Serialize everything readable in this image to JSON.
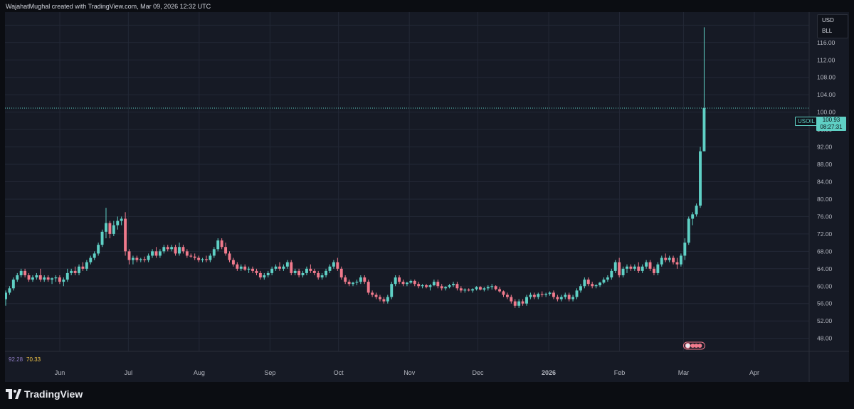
{
  "header": {
    "text": "WajahatMughal created with TradingView.com, Mar 09, 2026 12:32 UTC"
  },
  "units": {
    "currency": "USD",
    "measure": "BLL"
  },
  "symbol": {
    "name": "USOIL",
    "last_price": "100.93",
    "countdown": "08:27:31"
  },
  "oscillator": {
    "value_a": "92.28",
    "value_b": "70.33"
  },
  "brand": {
    "name": "TradingView"
  },
  "colors": {
    "up": "#5fd0c5",
    "down": "#f07a8c",
    "background": "#161a25",
    "grid": "#232836",
    "axis_text": "#b2b5be"
  },
  "chart_data": {
    "type": "candlestick",
    "symbol": "USOIL",
    "currency": "USD",
    "y_ticks": [
      48,
      52,
      56,
      60,
      64,
      68,
      72,
      76,
      80,
      84,
      88,
      92,
      96,
      100,
      104,
      108,
      112,
      116,
      120
    ],
    "y_tick_labels": [
      "48.00",
      "52.00",
      "56.00",
      "60.00",
      "64.00",
      "68.00",
      "72.00",
      "76.00",
      "80.00",
      "84.00",
      "88.00",
      "92.00",
      "96.00",
      "100.00",
      "104.00",
      "108.00",
      "112.00",
      "116.00",
      "120.00"
    ],
    "ylim": [
      45,
      123
    ],
    "x_labels": [
      "Jun",
      "Jul",
      "Aug",
      "Sep",
      "Oct",
      "Nov",
      "Dec",
      "2026",
      "Feb",
      "Mar",
      "Apr"
    ],
    "x_label_day_index": [
      24,
      54,
      85,
      116,
      146,
      177,
      207,
      238,
      269,
      297,
      328
    ],
    "x_range_days": [
      0,
      352
    ],
    "last_price": 100.93,
    "candles": [
      {
        "o": 57,
        "h": 59,
        "l": 55.5,
        "c": 58.5
      },
      {
        "o": 58.5,
        "h": 60,
        "l": 58,
        "c": 59.5
      },
      {
        "o": 59.5,
        "h": 62,
        "l": 59,
        "c": 61.5
      },
      {
        "o": 61.5,
        "h": 63,
        "l": 61,
        "c": 62.5
      },
      {
        "o": 62.5,
        "h": 64,
        "l": 62,
        "c": 63.5
      },
      {
        "o": 63.5,
        "h": 64,
        "l": 62,
        "c": 62.5
      },
      {
        "o": 62.5,
        "h": 63,
        "l": 61,
        "c": 61.5
      },
      {
        "o": 61.5,
        "h": 62.5,
        "l": 61,
        "c": 62
      },
      {
        "o": 62,
        "h": 63,
        "l": 61.5,
        "c": 62.5
      },
      {
        "o": 62.5,
        "h": 64,
        "l": 61,
        "c": 61.5
      },
      {
        "o": 61.5,
        "h": 62.5,
        "l": 61,
        "c": 62
      },
      {
        "o": 62,
        "h": 62.5,
        "l": 61,
        "c": 61.5
      },
      {
        "o": 61.5,
        "h": 62,
        "l": 60.5,
        "c": 61.8
      },
      {
        "o": 61.8,
        "h": 62.5,
        "l": 61,
        "c": 62
      },
      {
        "o": 62,
        "h": 62.5,
        "l": 60.5,
        "c": 61
      },
      {
        "o": 61,
        "h": 62,
        "l": 60,
        "c": 61.5
      },
      {
        "o": 61.5,
        "h": 64,
        "l": 61,
        "c": 63
      },
      {
        "o": 63,
        "h": 64,
        "l": 62.5,
        "c": 63.5
      },
      {
        "o": 63.5,
        "h": 64.5,
        "l": 62.5,
        "c": 63
      },
      {
        "o": 63,
        "h": 65,
        "l": 62.5,
        "c": 64.5
      },
      {
        "o": 64.5,
        "h": 65.5,
        "l": 63.5,
        "c": 64
      },
      {
        "o": 64,
        "h": 66,
        "l": 63.5,
        "c": 65.5
      },
      {
        "o": 65.5,
        "h": 67,
        "l": 65,
        "c": 66.5
      },
      {
        "o": 66.5,
        "h": 68,
        "l": 66,
        "c": 67.5
      },
      {
        "o": 67.5,
        "h": 70,
        "l": 67,
        "c": 69.5
      },
      {
        "o": 69.5,
        "h": 73,
        "l": 69,
        "c": 72.5
      },
      {
        "o": 72.5,
        "h": 78,
        "l": 71,
        "c": 74.5
      },
      {
        "o": 74.5,
        "h": 75,
        "l": 71,
        "c": 72
      },
      {
        "o": 72,
        "h": 75,
        "l": 71.5,
        "c": 74
      },
      {
        "o": 74,
        "h": 76,
        "l": 73,
        "c": 75
      },
      {
        "o": 75,
        "h": 76,
        "l": 74,
        "c": 75.5
      },
      {
        "o": 75.5,
        "h": 77,
        "l": 67,
        "c": 68
      },
      {
        "o": 68,
        "h": 68.5,
        "l": 65,
        "c": 66
      },
      {
        "o": 66,
        "h": 67,
        "l": 65,
        "c": 66.5
      },
      {
        "o": 66.5,
        "h": 67,
        "l": 65.5,
        "c": 66
      },
      {
        "o": 66,
        "h": 66.5,
        "l": 65.5,
        "c": 66.2
      },
      {
        "o": 66.2,
        "h": 66.8,
        "l": 65.5,
        "c": 66
      },
      {
        "o": 66,
        "h": 67.5,
        "l": 65.5,
        "c": 67
      },
      {
        "o": 67,
        "h": 68.5,
        "l": 66.5,
        "c": 68
      },
      {
        "o": 68,
        "h": 69,
        "l": 66.5,
        "c": 67
      },
      {
        "o": 67,
        "h": 68.5,
        "l": 66.5,
        "c": 68
      },
      {
        "o": 68,
        "h": 69.5,
        "l": 67.5,
        "c": 69
      },
      {
        "o": 69,
        "h": 69.5,
        "l": 68,
        "c": 68.5
      },
      {
        "o": 68.5,
        "h": 69.5,
        "l": 68,
        "c": 69
      },
      {
        "o": 69,
        "h": 69.5,
        "l": 67,
        "c": 67.5
      },
      {
        "o": 67.5,
        "h": 70,
        "l": 67,
        "c": 69
      },
      {
        "o": 69,
        "h": 69.5,
        "l": 67.5,
        "c": 68
      },
      {
        "o": 68,
        "h": 68.5,
        "l": 66.5,
        "c": 67
      },
      {
        "o": 67,
        "h": 67.5,
        "l": 66.5,
        "c": 66.8
      },
      {
        "o": 66.8,
        "h": 67.5,
        "l": 66,
        "c": 66.5
      },
      {
        "o": 66.5,
        "h": 67,
        "l": 65.5,
        "c": 66
      },
      {
        "o": 66,
        "h": 66.5,
        "l": 65.5,
        "c": 66.2
      },
      {
        "o": 66.2,
        "h": 67,
        "l": 65.5,
        "c": 66
      },
      {
        "o": 66,
        "h": 67.5,
        "l": 65.5,
        "c": 67
      },
      {
        "o": 67,
        "h": 69,
        "l": 66.5,
        "c": 68.5
      },
      {
        "o": 68.5,
        "h": 71,
        "l": 68,
        "c": 70.5
      },
      {
        "o": 70.5,
        "h": 71,
        "l": 68.5,
        "c": 69
      },
      {
        "o": 69,
        "h": 70,
        "l": 67,
        "c": 67.5
      },
      {
        "o": 67.5,
        "h": 68,
        "l": 65.5,
        "c": 66
      },
      {
        "o": 66,
        "h": 66.5,
        "l": 64.5,
        "c": 65
      },
      {
        "o": 65,
        "h": 65.5,
        "l": 63.5,
        "c": 64
      },
      {
        "o": 64,
        "h": 65,
        "l": 63.5,
        "c": 64.5
      },
      {
        "o": 64.5,
        "h": 65,
        "l": 63.5,
        "c": 63.8
      },
      {
        "o": 63.8,
        "h": 64.5,
        "l": 63,
        "c": 64
      },
      {
        "o": 64,
        "h": 64.5,
        "l": 63,
        "c": 63.5
      },
      {
        "o": 63.5,
        "h": 64,
        "l": 62.5,
        "c": 63
      },
      {
        "o": 63,
        "h": 63.5,
        "l": 61.5,
        "c": 62
      },
      {
        "o": 62,
        "h": 63,
        "l": 61.5,
        "c": 62.5
      },
      {
        "o": 62.5,
        "h": 63.5,
        "l": 62,
        "c": 63
      },
      {
        "o": 63,
        "h": 64.5,
        "l": 62.5,
        "c": 64
      },
      {
        "o": 64,
        "h": 65,
        "l": 63.5,
        "c": 64.5
      },
      {
        "o": 64.5,
        "h": 65.5,
        "l": 63.5,
        "c": 64
      },
      {
        "o": 64,
        "h": 65,
        "l": 63.5,
        "c": 64.5
      },
      {
        "o": 64.5,
        "h": 66,
        "l": 64,
        "c": 65.5
      },
      {
        "o": 65.5,
        "h": 66,
        "l": 62.5,
        "c": 63
      },
      {
        "o": 63,
        "h": 64,
        "l": 62.5,
        "c": 63.5
      },
      {
        "o": 63.5,
        "h": 64,
        "l": 62,
        "c": 62.5
      },
      {
        "o": 62.5,
        "h": 63.5,
        "l": 62,
        "c": 63
      },
      {
        "o": 63,
        "h": 64.5,
        "l": 62.5,
        "c": 64
      },
      {
        "o": 64,
        "h": 65,
        "l": 63,
        "c": 63.5
      },
      {
        "o": 63.5,
        "h": 64,
        "l": 62.5,
        "c": 63
      },
      {
        "o": 63,
        "h": 63.5,
        "l": 61.5,
        "c": 62
      },
      {
        "o": 62,
        "h": 63,
        "l": 61.5,
        "c": 62.5
      },
      {
        "o": 62.5,
        "h": 64,
        "l": 62,
        "c": 63.5
      },
      {
        "o": 63.5,
        "h": 65,
        "l": 63,
        "c": 64.5
      },
      {
        "o": 64.5,
        "h": 66,
        "l": 64,
        "c": 65.5
      },
      {
        "o": 65.5,
        "h": 66.5,
        "l": 63.5,
        "c": 64
      },
      {
        "o": 64,
        "h": 64.5,
        "l": 61.5,
        "c": 62
      },
      {
        "o": 62,
        "h": 62.5,
        "l": 60.5,
        "c": 61
      },
      {
        "o": 61,
        "h": 61.5,
        "l": 60,
        "c": 60.5
      },
      {
        "o": 60.5,
        "h": 61,
        "l": 60,
        "c": 60.8
      },
      {
        "o": 60.8,
        "h": 61.5,
        "l": 60.2,
        "c": 61
      },
      {
        "o": 61,
        "h": 62.5,
        "l": 60.5,
        "c": 62
      },
      {
        "o": 62,
        "h": 62.5,
        "l": 60.5,
        "c": 61
      },
      {
        "o": 61,
        "h": 61.5,
        "l": 58,
        "c": 58.5
      },
      {
        "o": 58.5,
        "h": 59,
        "l": 57.5,
        "c": 58
      },
      {
        "o": 58,
        "h": 58.5,
        "l": 57,
        "c": 57.5
      },
      {
        "o": 57.5,
        "h": 58,
        "l": 56.5,
        "c": 57
      },
      {
        "o": 57,
        "h": 57.5,
        "l": 56,
        "c": 56.5
      },
      {
        "o": 56.5,
        "h": 58,
        "l": 56,
        "c": 57.5
      },
      {
        "o": 57.5,
        "h": 61,
        "l": 57,
        "c": 60.5
      },
      {
        "o": 60.5,
        "h": 62.5,
        "l": 60,
        "c": 62
      },
      {
        "o": 62,
        "h": 62.5,
        "l": 60.5,
        "c": 61
      },
      {
        "o": 61,
        "h": 61.5,
        "l": 60,
        "c": 60.5
      },
      {
        "o": 60.5,
        "h": 61,
        "l": 60,
        "c": 60.8
      },
      {
        "o": 60.8,
        "h": 61.5,
        "l": 60.5,
        "c": 61.2
      },
      {
        "o": 61.2,
        "h": 61.5,
        "l": 60,
        "c": 60.5
      },
      {
        "o": 60.5,
        "h": 61,
        "l": 59.5,
        "c": 60
      },
      {
        "o": 60,
        "h": 60.5,
        "l": 59.5,
        "c": 60.2
      },
      {
        "o": 60.2,
        "h": 60.5,
        "l": 59.5,
        "c": 59.8
      },
      {
        "o": 59.8,
        "h": 60.5,
        "l": 59,
        "c": 60.2
      },
      {
        "o": 60.2,
        "h": 61.5,
        "l": 60,
        "c": 61
      },
      {
        "o": 61,
        "h": 61.5,
        "l": 59.5,
        "c": 60
      },
      {
        "o": 60,
        "h": 60.5,
        "l": 59,
        "c": 59.5
      },
      {
        "o": 59.5,
        "h": 60,
        "l": 59,
        "c": 59.8
      },
      {
        "o": 59.8,
        "h": 60.5,
        "l": 59.5,
        "c": 60.2
      },
      {
        "o": 60.2,
        "h": 61,
        "l": 59.8,
        "c": 60.5
      },
      {
        "o": 60.5,
        "h": 61,
        "l": 59,
        "c": 59.5
      },
      {
        "o": 59.5,
        "h": 60,
        "l": 58.5,
        "c": 59
      },
      {
        "o": 59,
        "h": 59.5,
        "l": 58.5,
        "c": 59.2
      },
      {
        "o": 59.2,
        "h": 59.5,
        "l": 58.8,
        "c": 59
      },
      {
        "o": 59,
        "h": 59.5,
        "l": 58.5,
        "c": 59.3
      },
      {
        "o": 59.3,
        "h": 60,
        "l": 59,
        "c": 59.8
      },
      {
        "o": 59.8,
        "h": 60,
        "l": 59,
        "c": 59.2
      },
      {
        "o": 59.2,
        "h": 59.8,
        "l": 58.8,
        "c": 59.5
      },
      {
        "o": 59.5,
        "h": 60.2,
        "l": 59,
        "c": 59.8
      },
      {
        "o": 59.8,
        "h": 60.5,
        "l": 59.2,
        "c": 60
      },
      {
        "o": 60,
        "h": 60.2,
        "l": 59,
        "c": 59.3
      },
      {
        "o": 59.3,
        "h": 59.8,
        "l": 58.5,
        "c": 58.8
      },
      {
        "o": 58.8,
        "h": 59,
        "l": 57.5,
        "c": 58
      },
      {
        "o": 58,
        "h": 58.5,
        "l": 57,
        "c": 57.5
      },
      {
        "o": 57.5,
        "h": 58,
        "l": 56,
        "c": 56.5
      },
      {
        "o": 56.5,
        "h": 57,
        "l": 55,
        "c": 55.5
      },
      {
        "o": 55.5,
        "h": 57,
        "l": 55,
        "c": 56.5
      },
      {
        "o": 56.5,
        "h": 57,
        "l": 55.5,
        "c": 56
      },
      {
        "o": 56,
        "h": 58,
        "l": 55.5,
        "c": 57.5
      },
      {
        "o": 57.5,
        "h": 58.5,
        "l": 57,
        "c": 58
      },
      {
        "o": 58,
        "h": 58.5,
        "l": 57,
        "c": 57.5
      },
      {
        "o": 57.5,
        "h": 58.5,
        "l": 57,
        "c": 58.2
      },
      {
        "o": 58.2,
        "h": 58.8,
        "l": 57.5,
        "c": 58
      },
      {
        "o": 58,
        "h": 58.5,
        "l": 57.5,
        "c": 58.2
      },
      {
        "o": 58.2,
        "h": 58.8,
        "l": 57.8,
        "c": 58.5
      },
      {
        "o": 58.5,
        "h": 59,
        "l": 57,
        "c": 57.5
      },
      {
        "o": 57.5,
        "h": 58,
        "l": 56.5,
        "c": 57
      },
      {
        "o": 57,
        "h": 58,
        "l": 56.5,
        "c": 57.5
      },
      {
        "o": 57.5,
        "h": 58.5,
        "l": 57,
        "c": 58
      },
      {
        "o": 58,
        "h": 58.5,
        "l": 56.5,
        "c": 57
      },
      {
        "o": 57,
        "h": 58,
        "l": 56.5,
        "c": 57.5
      },
      {
        "o": 57.5,
        "h": 59.5,
        "l": 57,
        "c": 59
      },
      {
        "o": 59,
        "h": 60.5,
        "l": 58.5,
        "c": 60
      },
      {
        "o": 60,
        "h": 62,
        "l": 59.5,
        "c": 61.5
      },
      {
        "o": 61.5,
        "h": 62,
        "l": 60,
        "c": 60.5
      },
      {
        "o": 60.5,
        "h": 61,
        "l": 59.5,
        "c": 60
      },
      {
        "o": 60,
        "h": 60.5,
        "l": 59.5,
        "c": 60.2
      },
      {
        "o": 60.2,
        "h": 61,
        "l": 59.8,
        "c": 60.8
      },
      {
        "o": 60.8,
        "h": 62,
        "l": 60.5,
        "c": 61.5
      },
      {
        "o": 61.5,
        "h": 62.5,
        "l": 61,
        "c": 62
      },
      {
        "o": 62,
        "h": 64,
        "l": 61.5,
        "c": 63.5
      },
      {
        "o": 63.5,
        "h": 66,
        "l": 63,
        "c": 65.5
      },
      {
        "o": 65.5,
        "h": 66.5,
        "l": 62,
        "c": 62.5
      },
      {
        "o": 62.5,
        "h": 64.5,
        "l": 62,
        "c": 64
      },
      {
        "o": 64,
        "h": 65,
        "l": 63,
        "c": 64.5
      },
      {
        "o": 64.5,
        "h": 65,
        "l": 63.5,
        "c": 64
      },
      {
        "o": 64,
        "h": 65,
        "l": 63.5,
        "c": 64.5
      },
      {
        "o": 64.5,
        "h": 65.5,
        "l": 63,
        "c": 63.5
      },
      {
        "o": 63.5,
        "h": 65,
        "l": 63,
        "c": 64.5
      },
      {
        "o": 64.5,
        "h": 66,
        "l": 64,
        "c": 65.5
      },
      {
        "o": 65.5,
        "h": 66,
        "l": 63.5,
        "c": 64
      },
      {
        "o": 64,
        "h": 64.5,
        "l": 62.5,
        "c": 63
      },
      {
        "o": 63,
        "h": 65.5,
        "l": 62.5,
        "c": 65
      },
      {
        "o": 65,
        "h": 67,
        "l": 64.5,
        "c": 66.5
      },
      {
        "o": 66.5,
        "h": 67.5,
        "l": 65.5,
        "c": 66
      },
      {
        "o": 66,
        "h": 67,
        "l": 65.5,
        "c": 66.5
      },
      {
        "o": 66.5,
        "h": 67,
        "l": 65,
        "c": 65.5
      },
      {
        "o": 65.5,
        "h": 66.5,
        "l": 64,
        "c": 65
      },
      {
        "o": 65,
        "h": 67.5,
        "l": 64.5,
        "c": 67
      },
      {
        "o": 67,
        "h": 71,
        "l": 66,
        "c": 70
      },
      {
        "o": 70,
        "h": 76,
        "l": 69.5,
        "c": 75.5
      },
      {
        "o": 75.5,
        "h": 77,
        "l": 74,
        "c": 76.5
      },
      {
        "o": 76.5,
        "h": 79,
        "l": 76,
        "c": 78.5
      },
      {
        "o": 78.5,
        "h": 92,
        "l": 78,
        "c": 91
      },
      {
        "o": 91,
        "h": 119.5,
        "l": 96,
        "c": 100.9
      }
    ]
  }
}
